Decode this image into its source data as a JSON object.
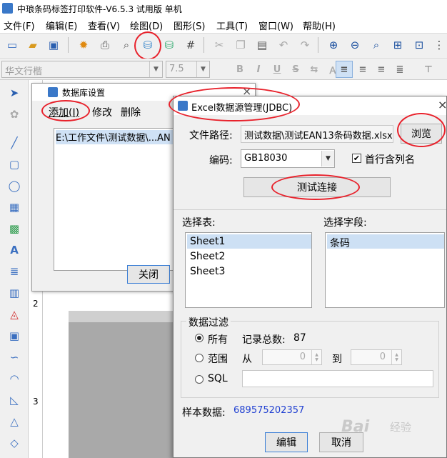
{
  "app": {
    "title": "中琅条码标签打印软件-V6.5.3 试用版 单机"
  },
  "menu": [
    "文件(F)",
    "编辑(E)",
    "查看(V)",
    "绘图(D)",
    "图形(S)",
    "工具(T)",
    "窗口(W)",
    "帮助(H)"
  ],
  "fontbar": {
    "font_name": "华文行楷",
    "font_size": "7.5"
  },
  "ruler": [
    "2",
    "3"
  ],
  "dbwindow": {
    "title": "数据库设置",
    "menu": [
      "添加(I)",
      "修改",
      "删除"
    ],
    "list_item": "E:\\工作文件\\测试数据\\...AN",
    "close_button": "关闭"
  },
  "excel": {
    "title": "Excel数据源管理(JDBC)",
    "path_label": "文件路径:",
    "path_value": "测试数据\\测试EAN13条码数据.xlsx",
    "browse": "浏览",
    "encoding_label": "编码:",
    "encoding_value": "GB18030",
    "header_checkbox": "首行含列名",
    "header_checked": true,
    "test_button": "测试连接",
    "tables_label": "选择表:",
    "tables": [
      "Sheet1",
      "Sheet2",
      "Sheet3"
    ],
    "fields_label": "选择字段:",
    "fields": [
      "条码"
    ],
    "filter": {
      "group_label": "数据过滤",
      "all_label": "所有",
      "total_label": "记录总数:",
      "total_value": "87",
      "range_label": "范围",
      "from_label": "从",
      "from_value": "0",
      "to_label": "到",
      "to_value": "0",
      "sql_label": "SQL"
    },
    "sample_label": "样本数据:",
    "sample_value": "689575202357",
    "edit_button": "编辑",
    "cancel_button": "取消"
  },
  "watermark": {
    "brand": "Bai",
    "suffix": "经验"
  },
  "colors": {
    "highlight_ring": "#e8212b",
    "sample_text": "#1f3fd1",
    "selection": "#cde0f4"
  }
}
